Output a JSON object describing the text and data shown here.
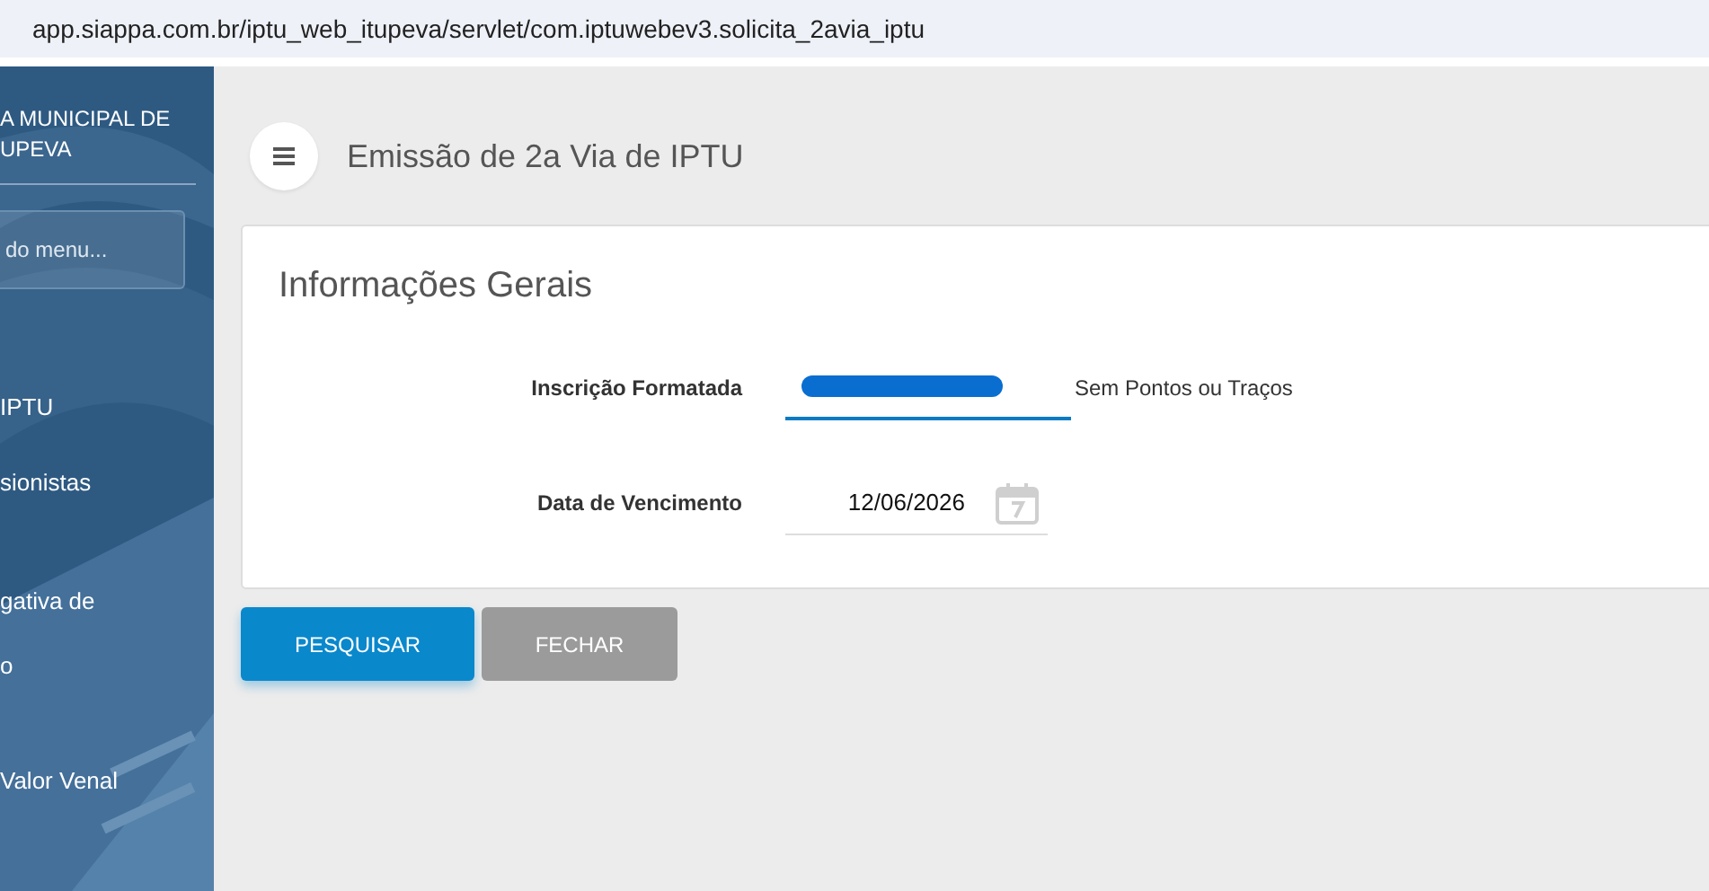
{
  "browser": {
    "url": "app.siappa.com.br/iptu_web_itupeva/servlet/com.iptuwebev3.solicita_2avia_iptu"
  },
  "sidebar": {
    "title_lines": [
      "A MUNICIPAL DE",
      "UPEVA"
    ],
    "search": {
      "placeholder": "do menu..."
    },
    "items": [
      {
        "label": "IPTU"
      },
      {
        "label": "sionistas"
      },
      {
        "label": "gativa de"
      },
      {
        "label": "o"
      },
      {
        "label": "Valor Venal"
      }
    ]
  },
  "header": {
    "title": "Emissão de 2a Via de IPTU"
  },
  "card": {
    "title": "Informações Gerais",
    "fields": [
      {
        "kind": "text",
        "label": "Inscrição Formatada",
        "hint": "Sem Pontos ou Traços",
        "focused": true
      },
      {
        "kind": "date",
        "label": "Data de Vencimento",
        "value": "12/06/2026",
        "focused": false
      }
    ]
  },
  "buttons": [
    {
      "kind": "primary",
      "label": "PESQUISAR"
    },
    {
      "kind": "secondary",
      "label": "FECHAR"
    }
  ]
}
